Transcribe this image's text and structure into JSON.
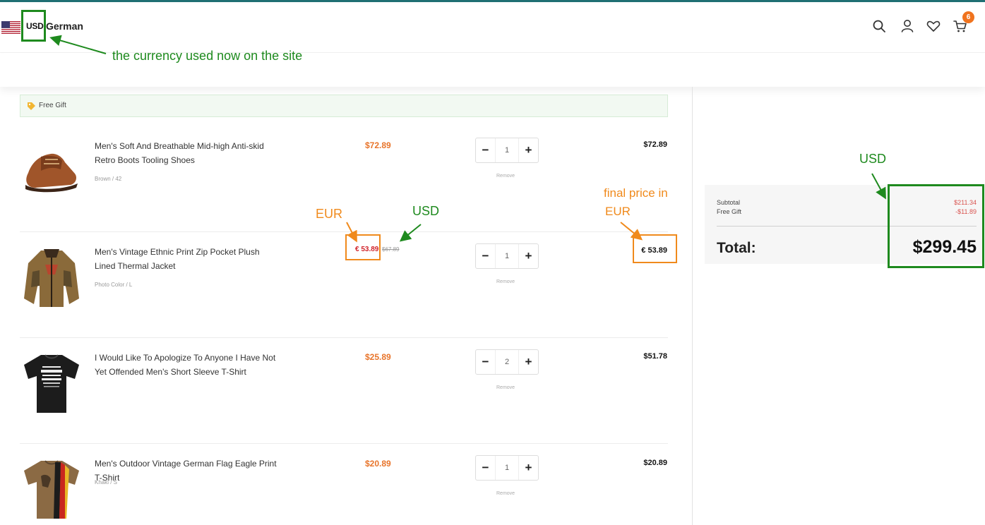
{
  "header": {
    "currency_code": "USD",
    "language": "German",
    "cart_count": "6"
  },
  "gift_bar": {
    "label": "Free Gift"
  },
  "cart": {
    "items": [
      {
        "name": "Men's Soft And Breathable Mid-high Anti-skid Retro Boots Tooling Shoes",
        "variant": "Brown / 42",
        "unit_price": "$72.89",
        "quantity": "1",
        "remove_label": "Remove",
        "line_total": "$72.89"
      },
      {
        "name": "Men's Vintage Ethnic Print Zip Pocket Plush Lined Thermal Jacket",
        "variant": "Photo Color / L",
        "sale_price": "€ 53.89",
        "original_price": "$67.89",
        "quantity": "1",
        "remove_label": "Remove",
        "line_total": "€ 53.89"
      },
      {
        "name": "I Would Like To Apologize To Anyone I Have Not Yet Offended Men's Short Sleeve T-Shirt",
        "variant": "",
        "unit_price": "$25.89",
        "quantity": "2",
        "remove_label": "Remove",
        "line_total": "$51.78"
      },
      {
        "name": "Men's Outdoor Vintage German Flag Eagle Print T-Shirt",
        "variant": "Khaki / S",
        "unit_price": "$20.89",
        "quantity": "1",
        "remove_label": "Remove",
        "line_total": "$20.89"
      }
    ]
  },
  "summary": {
    "subtotal_label": "Subtotal",
    "subtotal_value": "$211.34",
    "gift_label": "Free Gift",
    "gift_value": "-$11.89",
    "total_label": "Total:",
    "total_value": "$299.45"
  },
  "annotations": {
    "currency_note": "the currency used now on the site",
    "usd_summary": "USD",
    "eur_unit": "EUR",
    "usd_unit": "USD",
    "final_price_line1": "final price in",
    "final_price_line2": "EUR"
  },
  "colors": {
    "annotation_green": "#1e8a1e",
    "annotation_orange": "#f08a1c",
    "price_orange": "#e8742a",
    "sale_red": "#d1232a",
    "badge": "#f0731e"
  }
}
